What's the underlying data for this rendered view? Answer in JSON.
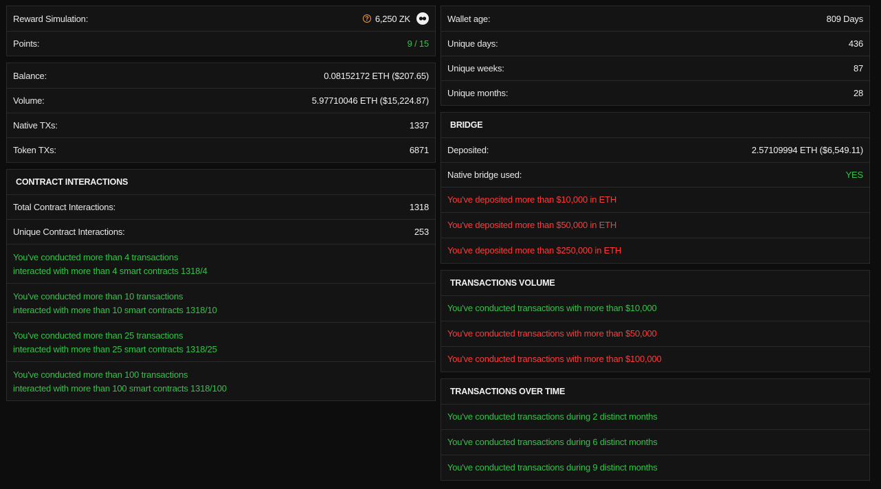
{
  "colors": {
    "background": "#0d0d0d",
    "panel": "#141414",
    "border": "#2a2a2a",
    "success": "#36c24a",
    "fail": "#ff3b3b",
    "warning_icon": "#f39a3a"
  },
  "left": {
    "reward": {
      "label": "Reward Simulation:",
      "value": "6,250 ZK",
      "info_icon": "question-circle-icon",
      "toggle_icon": "eye-icon"
    },
    "points": {
      "label": "Points:",
      "value": "9 / 15"
    },
    "stats": [
      {
        "label": "Balance:",
        "value": "0.08152172 ETH ($207.65)"
      },
      {
        "label": "Volume:",
        "value": "5.97710046 ETH ($15,224.87)"
      },
      {
        "label": "Native TXs:",
        "value": "1337"
      },
      {
        "label": "Token TXs:",
        "value": "6871"
      }
    ],
    "contracts": {
      "title": "CONTRACT INTERACTIONS",
      "rows": [
        {
          "label": "Total Contract Interactions:",
          "value": "1318"
        },
        {
          "label": "Unique Contract Interactions:",
          "value": "253"
        }
      ],
      "achievements": [
        {
          "line1": "You've conducted more than 4 transactions",
          "line2": "interacted with more than 4 smart contracts 1318/4",
          "status": "achieved"
        },
        {
          "line1": "You've conducted more than 10 transactions",
          "line2": "interacted with more than 10 smart contracts 1318/10",
          "status": "achieved"
        },
        {
          "line1": "You've conducted more than 25 transactions",
          "line2": "interacted with more than 25 smart contracts 1318/25",
          "status": "achieved"
        },
        {
          "line1": "You've conducted more than 100 transactions",
          "line2": "interacted with more than 100 smart contracts 1318/100",
          "status": "achieved"
        }
      ]
    }
  },
  "right": {
    "wallet": [
      {
        "label": "Wallet age:",
        "value": "809 Days"
      },
      {
        "label": "Unique days:",
        "value": "436"
      },
      {
        "label": "Unique weeks:",
        "value": "87"
      },
      {
        "label": "Unique months:",
        "value": "28"
      }
    ],
    "bridge": {
      "title": "BRIDGE",
      "deposited": {
        "label": "Deposited:",
        "value": "2.57109994 ETH ($6,549.11)"
      },
      "native": {
        "label": "Native bridge used:",
        "value": "YES"
      },
      "achievements": [
        {
          "text": "You've deposited more than $10,000 in ETH",
          "status": "not_achieved"
        },
        {
          "text": "You've deposited more than $50,000 in ETH",
          "status": "not_achieved"
        },
        {
          "text": "You've deposited more than $250,000 in ETH",
          "status": "not_achieved"
        }
      ]
    },
    "volume": {
      "title": "TRANSACTIONS VOLUME",
      "achievements": [
        {
          "text": "You've conducted transactions with more than $10,000",
          "status": "achieved"
        },
        {
          "text": "You've conducted transactions with more than $50,000",
          "status": "not_achieved"
        },
        {
          "text": "You've conducted transactions with more than $100,000",
          "status": "not_achieved"
        }
      ]
    },
    "overtime": {
      "title": "TRANSACTIONS OVER TIME",
      "achievements": [
        {
          "text": "You've conducted transactions during 2 distinct months",
          "status": "achieved"
        },
        {
          "text": "You've conducted transactions during 6 distinct months",
          "status": "achieved"
        },
        {
          "text": "You've conducted transactions during 9 distinct months",
          "status": "achieved"
        }
      ]
    }
  }
}
